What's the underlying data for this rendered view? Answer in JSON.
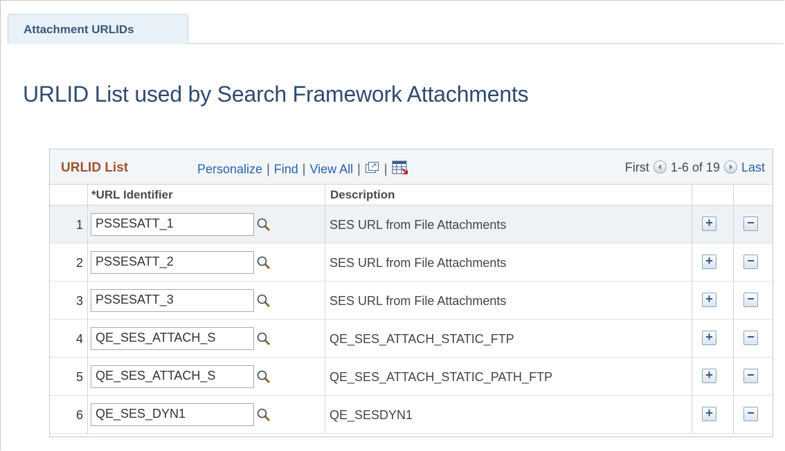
{
  "tab": {
    "label": "Attachment URLIDs"
  },
  "page": {
    "title": "URLID List used by Search Framework Attachments"
  },
  "grid": {
    "title": "URLID List",
    "links": {
      "personalize": "Personalize",
      "find": "Find",
      "view_all": "View All"
    },
    "pager": {
      "first": "First",
      "range": "1-6 of 19",
      "last": "Last"
    },
    "columns": {
      "url_identifier": "*URL Identifier",
      "description": "Description"
    },
    "rows": [
      {
        "num": "1",
        "url_id": "PSSESATT_1",
        "description": "SES URL from File Attachments"
      },
      {
        "num": "2",
        "url_id": "PSSESATT_2",
        "description": "SES URL from File Attachments"
      },
      {
        "num": "3",
        "url_id": "PSSESATT_3",
        "description": "SES URL from File Attachments"
      },
      {
        "num": "4",
        "url_id": "QE_SES_ATTACH_S",
        "description": "QE_SES_ATTACH_STATIC_FTP"
      },
      {
        "num": "5",
        "url_id": "QE_SES_ATTACH_S",
        "description": "QE_SES_ATTACH_STATIC_PATH_FTP"
      },
      {
        "num": "6",
        "url_id": "QE_SES_DYN1",
        "description": "QE_SESDYN1"
      }
    ],
    "row_buttons": {
      "add": "+",
      "delete": "−"
    }
  },
  "icons": {
    "zoom": "new-window-icon",
    "download": "download-to-excel-icon",
    "lookup": "magnifier-icon",
    "first_arrow": "left-arrow-circle-icon",
    "last_arrow": "right-arrow-circle-icon"
  },
  "colors": {
    "title": "#2e4a6e",
    "grid_title": "#a0522d",
    "link": "#2a63a8"
  }
}
